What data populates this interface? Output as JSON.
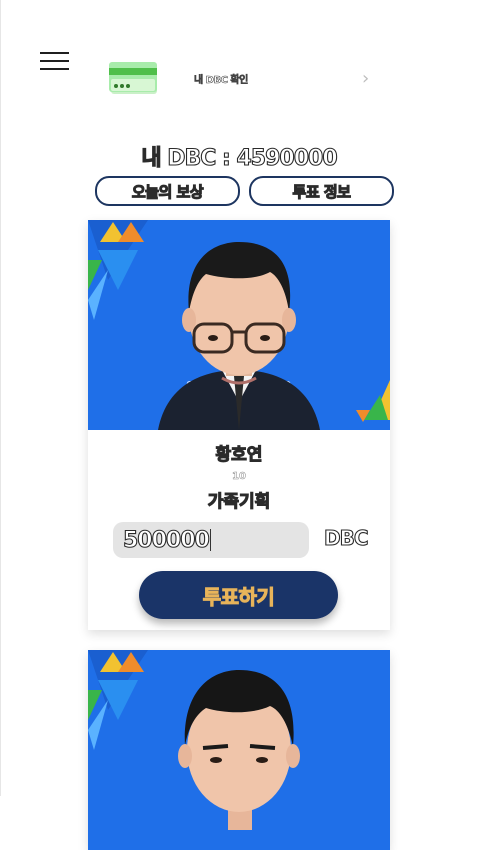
{
  "header": {
    "menu_icon": "hamburger-menu-icon",
    "wallet_icon": "card-icon",
    "wallet_link_label": "내 DBC 확인",
    "wallet_link_chevron": "›"
  },
  "balance": {
    "text": "내 DBC : 4590000"
  },
  "actions": {
    "daily_reward_label": "오늘의 보상",
    "vote_info_label": "투표 정보"
  },
  "candidates": [
    {
      "name": "황호연",
      "number": "10",
      "department": "가족기획",
      "amount_value": "500000",
      "unit": "DBC",
      "vote_label": "투표하기"
    }
  ],
  "colors": {
    "accent_navy": "#1a3468",
    "photo_background": "#1f6fe8",
    "card_icon_green": "#7ee27a"
  }
}
